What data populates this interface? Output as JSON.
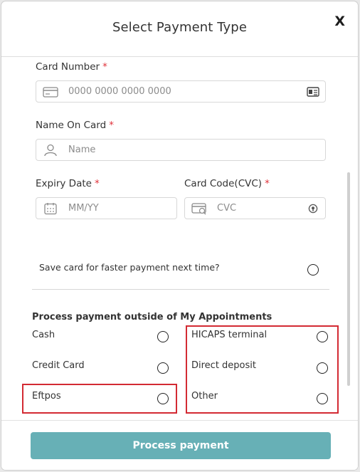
{
  "modal": {
    "title": "Select Payment Type",
    "close_label": "X"
  },
  "card_number": {
    "label": "Card Number",
    "required": "*",
    "placeholder": "0000 0000 0000 0000",
    "icon": "credit-card-icon",
    "right_icon": "card-scan-icon"
  },
  "name_on_card": {
    "label": "Name On Card",
    "required": "*",
    "placeholder": "Name",
    "icon": "user-icon"
  },
  "expiry": {
    "label": "Expiry Date",
    "required": "*",
    "placeholder": "MM/YY",
    "icon": "calendar-icon"
  },
  "cvc": {
    "label": "Card Code(CVC)",
    "required": "*",
    "placeholder": "CVC",
    "icon": "card-security-icon",
    "right_icon": "help-icon"
  },
  "save_card": {
    "label": "Save card for faster payment next time?"
  },
  "outside": {
    "title": "Process payment outside of My Appointments",
    "left_options": [
      "Cash",
      "Credit Card",
      "Eftpos"
    ],
    "right_options": [
      "HICAPS terminal",
      "Direct deposit",
      "Other"
    ]
  },
  "footer": {
    "process_label": "Process payment"
  },
  "colors": {
    "accent": "#67b0b6",
    "required": "#e0323b",
    "highlight": "#d32a33"
  }
}
